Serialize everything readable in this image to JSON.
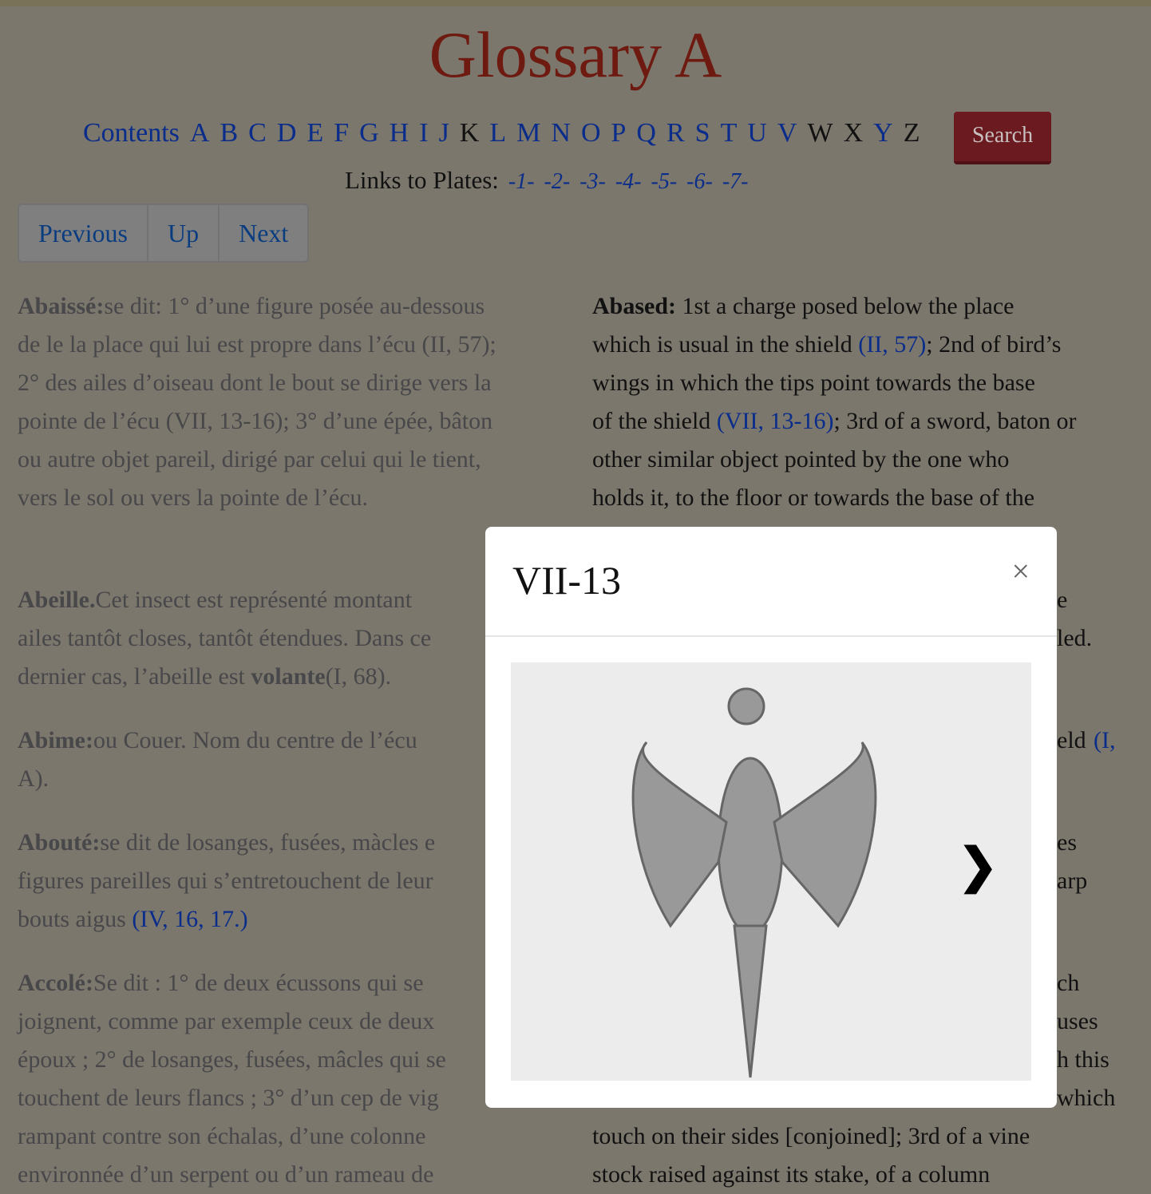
{
  "title": "Glossary A",
  "nav": {
    "contents": "Contents",
    "letters": [
      "A",
      "B",
      "C",
      "D",
      "E",
      "F",
      "G",
      "H",
      "I",
      "J",
      "K",
      "L",
      "M",
      "N",
      "O",
      "P",
      "Q",
      "R",
      "S",
      "T",
      "U",
      "V",
      "W",
      "X",
      "Y",
      "Z"
    ],
    "search": "Search"
  },
  "plates": {
    "label": "Links to Plates:",
    "links": [
      "-1-",
      "-2-",
      "-3-",
      "-4-",
      "-5-",
      "-6-",
      "-7-"
    ]
  },
  "pager": {
    "previous": "Previous",
    "up": "Up",
    "next": "Next"
  },
  "left_lines": [
    [
      "Abaissé:",
      "se dit: 1° d’une figure posée au-dessous",
      ""
    ],
    [
      "",
      "de le la place qui lui est propre dans l’écu (II, 57);",
      ""
    ],
    [
      "",
      "2° des ailes d’oiseau dont le bout se dirige vers la",
      ""
    ],
    [
      "",
      "pointe de l’écu (VII, 13-16); 3° d’une épée, bâton",
      ""
    ],
    [
      "",
      "ou autre objet pareil, dirigé par celui qui le tient,",
      ""
    ],
    [
      "",
      "vers le sol ou vers la pointe de l’écu.",
      ""
    ],
    [
      "Abeille.",
      "Cet insect est représenté montant",
      ""
    ],
    [
      "",
      "ailes tantôt closes, tantôt étendues. Dans ce",
      ""
    ],
    [
      "",
      "dernier cas, l’abeille est ",
      "volante"
    ],
    [
      "Abime:",
      "ou Couer. Nom du centre de l’écu",
      ""
    ],
    [
      "",
      "A).",
      ""
    ],
    [
      "Abouté:",
      "se dit de losanges, fusées, màcles e",
      ""
    ],
    [
      "",
      "figures pareilles qui s’entretouchent de leur",
      ""
    ],
    [
      "",
      "bouts aigus ",
      ""
    ],
    [
      "Accolé:",
      "Se dit : 1° de deux écussons qui se",
      ""
    ],
    [
      "",
      "joignent, comme par exemple ceux de deux",
      ""
    ],
    [
      "",
      "époux ; 2° de losanges, fusées, mâcles qui se",
      ""
    ],
    [
      "",
      "touchent de leurs flancs ; 3° d’un cep de vig",
      ""
    ],
    [
      "",
      "rampant contre son échalas, d’une colonne",
      ""
    ],
    [
      "",
      "environnée d’un serpent ou d’un rameau de",
      ""
    ]
  ],
  "left_extra": {
    "abeille_ref": "(I, 68).",
    "aboute_ref": "(IV, 16, 17.)"
  },
  "right_lines": [
    [
      "Abased:",
      " 1st a charge posed below the place"
    ],
    [
      "",
      "which is usual in the shield "
    ],
    [
      "",
      "wings in which the tips point towards the base"
    ],
    [
      "",
      "of the shield "
    ],
    [
      "",
      "other similar object pointed by the one who"
    ],
    [
      "",
      "holds it, to the floor or towards the base of the"
    ],
    [
      "",
      "touch on their sides [conjoined]; 3rd of a vine"
    ],
    [
      "",
      "stock raised against its stake, of a column"
    ]
  ],
  "right_refs": {
    "r1": "(II, 57)",
    "r1b": "; 2nd of bird’s",
    "r2": "(VII, 13-16)",
    "r2b": "; 3rd of a sword, baton or"
  },
  "right_fragments": [
    "e",
    "led.",
    "eld ",
    "(I,",
    "es",
    "arp",
    "ch",
    "uses",
    "h this",
    "which"
  ],
  "modal": {
    "title": "VII-13",
    "close": "×",
    "next": "❯"
  }
}
